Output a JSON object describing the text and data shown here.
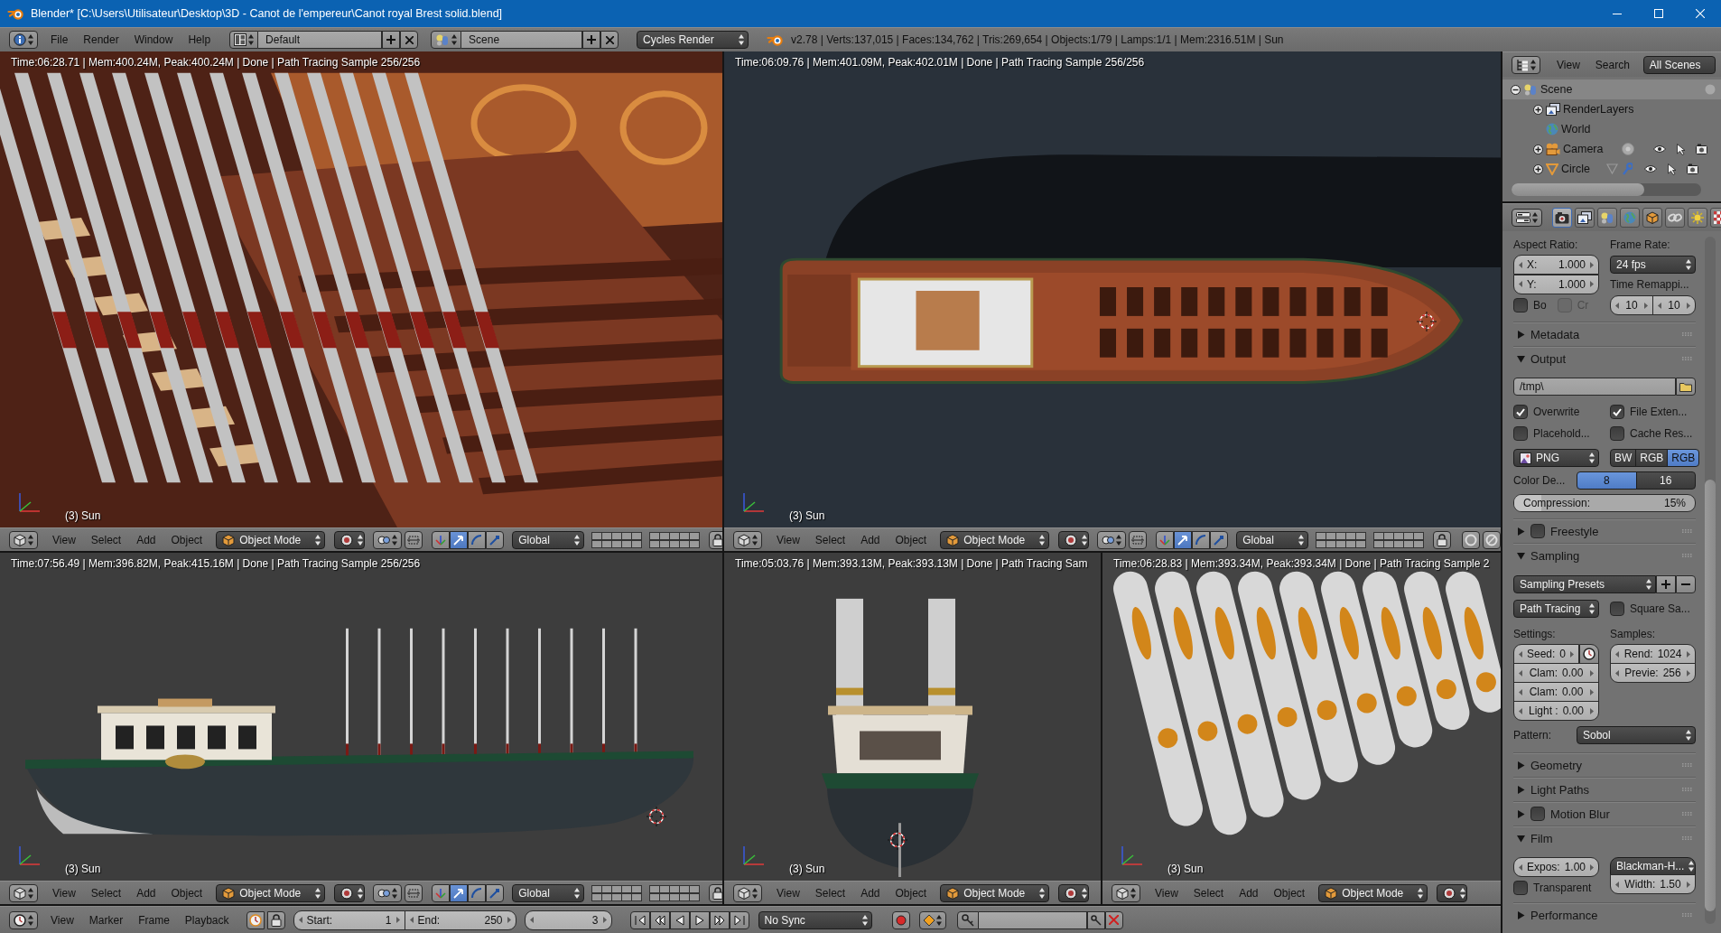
{
  "window": {
    "title": "Blender* [C:\\Users\\Utilisateur\\Desktop\\3D - Canot de l'empereur\\Canot royal Brest solid.blend]"
  },
  "info_header": {
    "menus": [
      "File",
      "Render",
      "Window",
      "Help"
    ],
    "screen_layout": "Default",
    "scene": "Scene",
    "render_engine": "Cycles Render",
    "stats": "v2.78 | Verts:137,015 | Faces:134,762 | Tris:269,654 | Objects:1/79 | Lamps:1/1 | Mem:2316.51M | Sun"
  },
  "viewport_rows": [
    {
      "viewports": [
        {
          "kind": "interior",
          "render_info": "Time:06:28.71 | Mem:400.24M, Peak:400.24M | Done | Path Tracing Sample 256/256",
          "object_label": "(3) Sun",
          "header": {
            "menus": [
              "View",
              "Select",
              "Add",
              "Object"
            ],
            "mode": "Object Mode",
            "manipulators": [
              {
                "kind": "translate",
                "selected": true
              },
              {
                "kind": "rotate",
                "selected": false
              },
              {
                "kind": "scale",
                "selected": false
              }
            ],
            "orientation": "Global"
          }
        },
        {
          "kind": "top",
          "render_info": "Time:06:09.76 | Mem:401.09M, Peak:402.01M | Done | Path Tracing Sample 256/256",
          "object_label": "(3) Sun",
          "header": {
            "menus": [
              "View",
              "Select",
              "Add",
              "Object"
            ],
            "mode": "Object Mode",
            "manipulators": [
              {
                "kind": "translate",
                "selected": true
              },
              {
                "kind": "rotate",
                "selected": false
              },
              {
                "kind": "scale",
                "selected": false
              }
            ],
            "orientation": "Global"
          }
        }
      ]
    },
    {
      "viewports": [
        {
          "kind": "side",
          "render_info": "Time:07:56.49 | Mem:396.82M, Peak:415.16M | Done | Path Tracing Sample 256/256",
          "object_label": "(3) Sun",
          "header": {
            "menus": [
              "View",
              "Select",
              "Add",
              "Object"
            ],
            "mode": "Object Mode",
            "manipulators": [
              {
                "kind": "translate",
                "selected": true
              },
              {
                "kind": "rotate",
                "selected": false
              },
              {
                "kind": "scale",
                "selected": false
              }
            ],
            "orientation": "Global"
          }
        },
        {
          "kind": "stern",
          "render_info": "Time:05:03.76 | Mem:393.13M, Peak:393.13M | Done | Path Tracing Sam",
          "object_label": "(3) Sun",
          "header": {
            "menus": [
              "View",
              "Select",
              "Add",
              "Object"
            ],
            "mode": "Object Mode"
          }
        },
        {
          "kind": "oars",
          "render_info": "Time:06:28.83 | Mem:393.34M, Peak:393.34M | Done | Path Tracing Sample 2",
          "object_label": "(3) Sun",
          "header": {
            "menus": [
              "View",
              "Select",
              "Add",
              "Object"
            ],
            "mode": "Object Mode"
          }
        }
      ]
    }
  ],
  "timeline": {
    "menus": [
      "View",
      "Marker",
      "Frame",
      "Playback"
    ],
    "start": {
      "label": "Start:",
      "value": "1"
    },
    "end": {
      "label": "End:",
      "value": "250"
    },
    "current_frame": "3",
    "sync": "No Sync"
  },
  "outliner": {
    "menus": [
      "View",
      "Search"
    ],
    "display_mode": "All Scenes",
    "tree": [
      {
        "label": "Scene",
        "kind": "scene",
        "expanded": true,
        "selected": true,
        "children": [
          {
            "label": "RenderLayers",
            "kind": "render_layers",
            "expanded": false,
            "selected": false
          },
          {
            "label": "World",
            "kind": "world",
            "selected": false
          },
          {
            "label": "Camera",
            "kind": "camera",
            "expanded": false,
            "selected": false
          },
          {
            "label": "Circle",
            "kind": "mesh",
            "expanded": false,
            "selected": false
          }
        ]
      }
    ]
  },
  "properties": {
    "tabs": [
      {
        "kind": "render",
        "selected": true
      },
      {
        "kind": "render_layers",
        "selected": false
      },
      {
        "kind": "scene",
        "selected": false
      },
      {
        "kind": "world",
        "selected": false
      },
      {
        "kind": "object",
        "selected": false
      },
      {
        "kind": "constraints",
        "selected": false
      },
      {
        "kind": "data",
        "selected": false
      },
      {
        "kind": "texture",
        "selected": false
      }
    ],
    "dimensions": {
      "aspect_label": "Aspect Ratio:",
      "aspect": [
        {
          "label": "X:",
          "value": "1.000"
        },
        {
          "label": "Y:",
          "value": "1.000"
        }
      ],
      "frame_rate_label": "Frame Rate:",
      "frame_rate": "24 fps",
      "time_remap_label": "Time Remappi...",
      "time_remap": [
        "10",
        "10"
      ],
      "checks": [
        {
          "label": "Bo",
          "checked": false,
          "disabled": false
        },
        {
          "label": "Cr",
          "checked": false,
          "disabled": true
        }
      ]
    },
    "panels": [
      {
        "title": "Metadata",
        "expanded": false
      },
      {
        "kind": "output",
        "title": "Output",
        "expanded": true,
        "path": "/tmp\\",
        "checks": [
          {
            "label": "Overwrite",
            "checked": true
          },
          {
            "label": "File Exten...",
            "checked": true
          },
          {
            "label": "Placehold...",
            "checked": false
          },
          {
            "label": "Cache Res...",
            "checked": false
          }
        ],
        "file_format": "PNG",
        "color_modes": [
          {
            "label": "BW",
            "selected": false
          },
          {
            "label": "RGB",
            "selected": false
          },
          {
            "label": "RGB",
            "selected": true
          }
        ],
        "color_depth": {
          "label": "Color De...",
          "options": [
            {
              "label": "8",
              "selected": true
            },
            {
              "label": "16",
              "selected": false
            }
          ]
        },
        "compression": {
          "label": "Compression:",
          "reading": "15%",
          "level": 0.15
        }
      },
      {
        "title": "Freestyle",
        "expanded": false,
        "toggle": {
          "checked": false
        }
      },
      {
        "kind": "sampling",
        "title": "Sampling",
        "expanded": true,
        "presets": "Sampling Presets",
        "integrator": "Path Tracing",
        "square_samples": {
          "label": "Square Sa...",
          "checked": false
        },
        "settings_label": "Settings:",
        "settings": [
          {
            "label": "Seed:",
            "value": "0"
          },
          {
            "label": "Clam:",
            "value": "0.00"
          },
          {
            "label": "Clam:",
            "value": "0.00"
          },
          {
            "label": "Light :",
            "value": "0.00"
          }
        ],
        "samples_label": "Samples:",
        "samples": [
          {
            "label": "Rend:",
            "value": "1024"
          },
          {
            "label": "Previe:",
            "value": "256"
          }
        ],
        "pattern": {
          "label": "Pattern:",
          "value": "Sobol"
        }
      },
      {
        "title": "Geometry",
        "expanded": false
      },
      {
        "title": "Light Paths",
        "expanded": false
      },
      {
        "title": "Motion Blur",
        "expanded": false,
        "toggle": {
          "checked": false
        }
      },
      {
        "kind": "film",
        "title": "Film",
        "expanded": true,
        "exposure": {
          "label": "Expos:",
          "value": "1.00"
        },
        "transparent": {
          "label": "Transparent",
          "checked": false
        },
        "filter": "Blackman-H...",
        "filter_width": {
          "label": "Width:",
          "value": "1.50"
        }
      },
      {
        "title": "Performance",
        "expanded": false
      }
    ]
  }
}
